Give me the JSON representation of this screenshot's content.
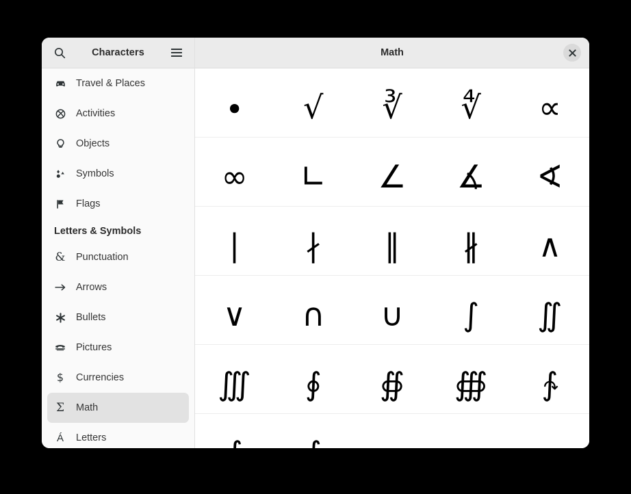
{
  "window": {
    "sidebar_title": "Characters",
    "main_title": "Math"
  },
  "sidebar": {
    "search_icon": "search-icon",
    "menu_icon": "hamburger-menu-icon",
    "items": [
      {
        "label": "Travel & Places",
        "icon": "car-icon",
        "glyph": "⛌",
        "selected": false,
        "section": false
      },
      {
        "label": "Activities",
        "icon": "activities-icon",
        "glyph": "⚾",
        "selected": false,
        "section": false
      },
      {
        "label": "Objects",
        "icon": "lightbulb-icon",
        "glyph": "Ὂ1",
        "selected": false,
        "section": false
      },
      {
        "label": "Symbols",
        "icon": "shapes-icon",
        "glyph": "❖",
        "selected": false,
        "section": false
      },
      {
        "label": "Flags",
        "icon": "flag-icon",
        "glyph": "⚑",
        "selected": false,
        "section": false
      },
      {
        "label": "Letters & Symbols",
        "icon": "",
        "glyph": "",
        "selected": false,
        "section": true
      },
      {
        "label": "Punctuation",
        "icon": "ampersand-icon",
        "glyph": "&",
        "selected": false,
        "section": false
      },
      {
        "label": "Arrows",
        "icon": "arrow-right-icon",
        "glyph": "→",
        "selected": false,
        "section": false
      },
      {
        "label": "Bullets",
        "icon": "asterisk-icon",
        "glyph": "✱",
        "selected": false,
        "section": false
      },
      {
        "label": "Pictures",
        "icon": "telephone-icon",
        "glyph": "☎",
        "selected": false,
        "section": false
      },
      {
        "label": "Currencies",
        "icon": "dollar-icon",
        "glyph": "$",
        "selected": false,
        "section": false
      },
      {
        "label": "Math",
        "icon": "sigma-icon",
        "glyph": "Σ",
        "selected": true,
        "section": false
      },
      {
        "label": "Letters",
        "icon": "accented-a-icon",
        "glyph": "Á",
        "selected": false,
        "section": false
      }
    ]
  },
  "close_button": {
    "icon": "close-icon",
    "label": "×"
  },
  "character_grid": {
    "rows": [
      [
        {
          "char": "∙",
          "name": "bullet-operator"
        },
        {
          "char": "√",
          "name": "square-root"
        },
        {
          "char": "∛",
          "name": "cube-root"
        },
        {
          "char": "∜",
          "name": "fourth-root"
        },
        {
          "char": "∝",
          "name": "proportional-to"
        }
      ],
      [
        {
          "char": "∞",
          "name": "infinity"
        },
        {
          "char": "∟",
          "name": "right-angle"
        },
        {
          "char": "∠",
          "name": "angle"
        },
        {
          "char": "∡",
          "name": "measured-angle"
        },
        {
          "char": "∢",
          "name": "spherical-angle"
        }
      ],
      [
        {
          "char": "∣",
          "name": "divides"
        },
        {
          "char": "∤",
          "name": "does-not-divide"
        },
        {
          "char": "∥",
          "name": "parallel-to"
        },
        {
          "char": "∦",
          "name": "not-parallel-to"
        },
        {
          "char": "∧",
          "name": "logical-and"
        }
      ],
      [
        {
          "char": "∨",
          "name": "logical-or"
        },
        {
          "char": "∩",
          "name": "intersection"
        },
        {
          "char": "∪",
          "name": "union"
        },
        {
          "char": "∫",
          "name": "integral"
        },
        {
          "char": "∬",
          "name": "double-integral"
        }
      ],
      [
        {
          "char": "∭",
          "name": "triple-integral"
        },
        {
          "char": "∮",
          "name": "contour-integral"
        },
        {
          "char": "∯",
          "name": "surface-integral"
        },
        {
          "char": "∰",
          "name": "volume-integral"
        },
        {
          "char": "∱",
          "name": "clockwise-integral"
        }
      ],
      [
        {
          "char": "∲",
          "name": "clockwise-contour-integral"
        },
        {
          "char": "∳",
          "name": "anticlockwise-contour-integral"
        },
        {
          "char": "",
          "name": "empty-cell"
        },
        {
          "char": "",
          "name": "empty-cell"
        },
        {
          "char": "",
          "name": "empty-cell"
        }
      ]
    ]
  }
}
